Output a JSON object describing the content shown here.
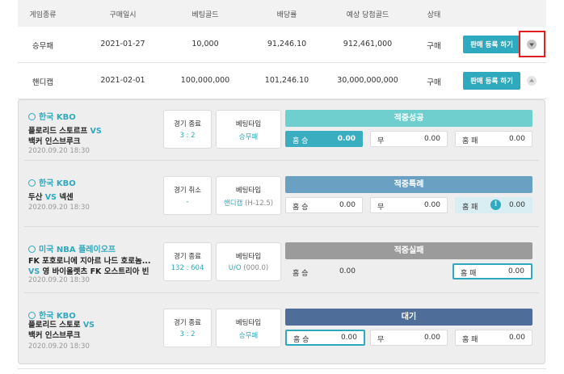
{
  "table": {
    "headers": [
      "게임종류",
      "구매일시",
      "베팅골드",
      "배당률",
      "예상 당첨골드",
      "상태"
    ],
    "rows": [
      {
        "game_type": "승무패",
        "date": "2021-01-27",
        "bet_gold": "10,000",
        "odds": "91,246.10",
        "expected_gold": "912,461,000",
        "status": "구매",
        "sell_label": "판매 등록 하기",
        "toggle": "expand"
      },
      {
        "game_type": "핸디캡",
        "date": "2021-02-01",
        "bet_gold": "100,000,000",
        "odds": "101,246.10",
        "expected_gold": "30,000,000,000",
        "status": "구매",
        "sell_label": "판매 등록 하기",
        "toggle": "collapse"
      }
    ]
  },
  "matches": [
    {
      "league": "한국 KBO",
      "team_line1": "플로리드 스토르프",
      "vs_line1": "VS",
      "team_line2": "백커 인스브루크",
      "vs_line2": "",
      "datetime": "2020.09.20  18:30",
      "game_status": "경기 종료",
      "score": "3 : 2",
      "bet_type_label": "베팅타입",
      "bet_type": "승무패",
      "bet_type_extra": "",
      "result": "적중성공",
      "result_color": "#6fcfcf",
      "odds": [
        {
          "label": "홈 승",
          "value": "0.00"
        },
        {
          "label": "무",
          "value": "0.00"
        },
        {
          "label": "홈 패",
          "value": "0.00"
        }
      ]
    },
    {
      "league": "한국 KBO",
      "team_line1": "두산",
      "vs_line1": "VS",
      "team_line1b": "넥센",
      "team_line2": "",
      "vs_line2": "",
      "datetime": "2020.09.20  18:30",
      "game_status": "경기 취소",
      "score": "-",
      "bet_type_label": "베팅타입",
      "bet_type": "핸디캡",
      "bet_type_extra": "(H-12.5)",
      "result": "적중특례",
      "result_color": "#6aa1c2",
      "odds": [
        {
          "label": "홈 승",
          "value": "0.00"
        },
        {
          "label": "무",
          "value": "0.00"
        },
        {
          "label": "홈 패",
          "value": "0.00",
          "badge": "!"
        }
      ]
    },
    {
      "league": "미국 NBA 플레이오프",
      "team_line1": "FK 포호로니에 지아르 나드 호로놈...",
      "vs_line1": "",
      "team_line2": "영 바이올렛츠 FK 오스트리아 빈",
      "vs_line2": "VS",
      "datetime": "2020.09.20  18:30",
      "game_status": "경기 종료",
      "score": "132 : 604",
      "bet_type_label": "베팅타입",
      "bet_type": "U/O",
      "bet_type_extra": "(000.0)",
      "result": "적중실패",
      "result_color": "#9b9b9b",
      "odds": [
        {
          "label": "홈 승",
          "value": "0.00"
        },
        {
          "label": "홈 패",
          "value": "0.00"
        }
      ]
    },
    {
      "league": "한국 KBO",
      "team_line1": "플로리드 스토로",
      "vs_line1": "VS",
      "team_line2": "백커 인스브루크",
      "vs_line2": "",
      "datetime": "2020.09.20  18:30",
      "game_status": "경기 종료",
      "score": "3 : 2",
      "bet_type_label": "베팅타입",
      "bet_type": "승무패",
      "bet_type_extra": "",
      "result": "대기",
      "result_color": "#4e6d99",
      "odds": [
        {
          "label": "홈 승",
          "value": "0.00"
        },
        {
          "label": "무",
          "value": "0.00"
        },
        {
          "label": "홈 패",
          "value": "0.00"
        }
      ]
    }
  ]
}
